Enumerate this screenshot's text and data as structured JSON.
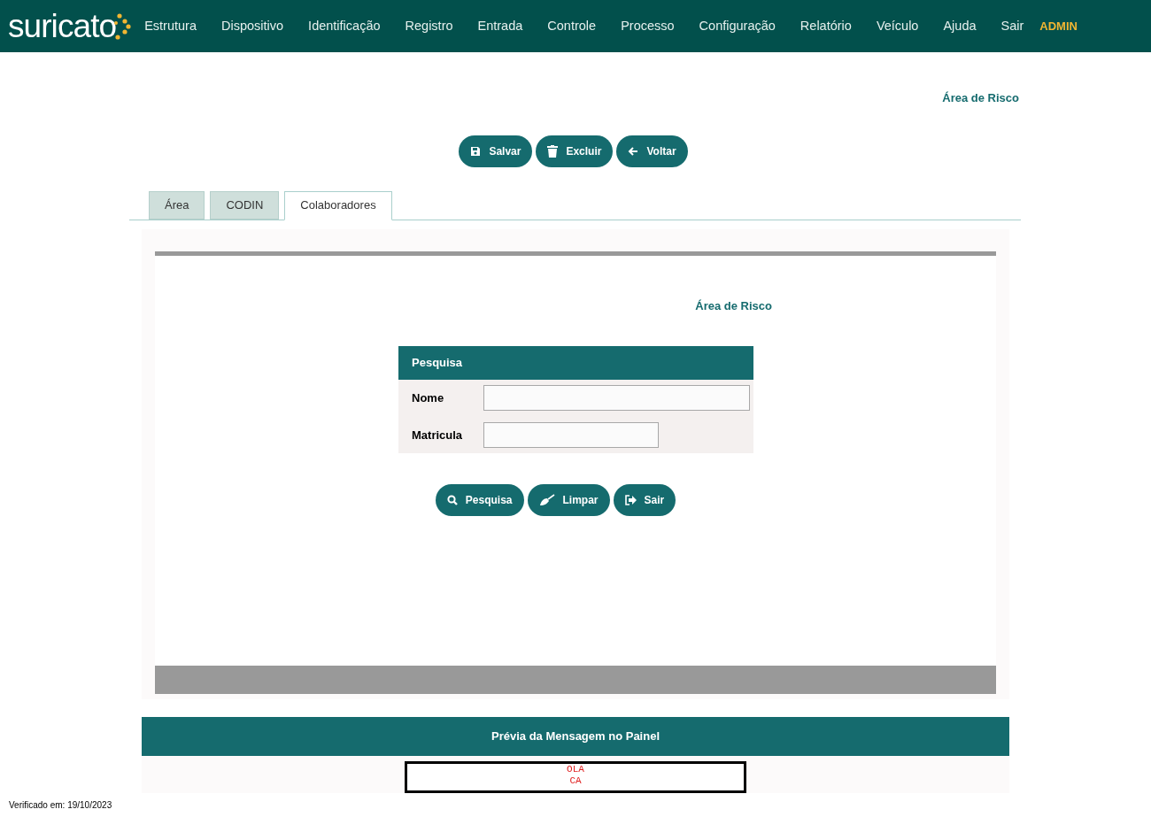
{
  "logo": "suricato",
  "nav": {
    "items": [
      "Estrutura",
      "Dispositivo",
      "Identificação",
      "Registro",
      "Entrada",
      "Controle",
      "Processo",
      "Configuração",
      "Relatório",
      "Veículo",
      "Ajuda",
      "Sair"
    ],
    "user": "ADMIN"
  },
  "page_title": "Área de Risco",
  "actions": [
    {
      "label": "Salvar",
      "kind": "save"
    },
    {
      "label": "Excluir",
      "kind": "delete"
    },
    {
      "label": "Voltar",
      "kind": "back"
    }
  ],
  "tabs": [
    {
      "label": "Área",
      "selected": false
    },
    {
      "label": "CODIN",
      "selected": false
    },
    {
      "label": "Colaboradores",
      "selected": true
    }
  ],
  "panel": {
    "title": "Área de Risco",
    "search": {
      "title": "Pesquisa",
      "fields": [
        {
          "label": "Nome",
          "kind": "wide"
        },
        {
          "label": "Matricula",
          "kind": "narrow"
        }
      ]
    },
    "actions": [
      {
        "label": "Pesquisa",
        "kind": "search"
      },
      {
        "label": "Limpar",
        "kind": "clear"
      },
      {
        "label": "Sair",
        "kind": "exit"
      }
    ]
  },
  "preview": {
    "title": "Prévia da Mensagem no Painel",
    "lines": [
      "OLA",
      "CA"
    ]
  },
  "footer": "Verificado em: 19/10/2023"
}
